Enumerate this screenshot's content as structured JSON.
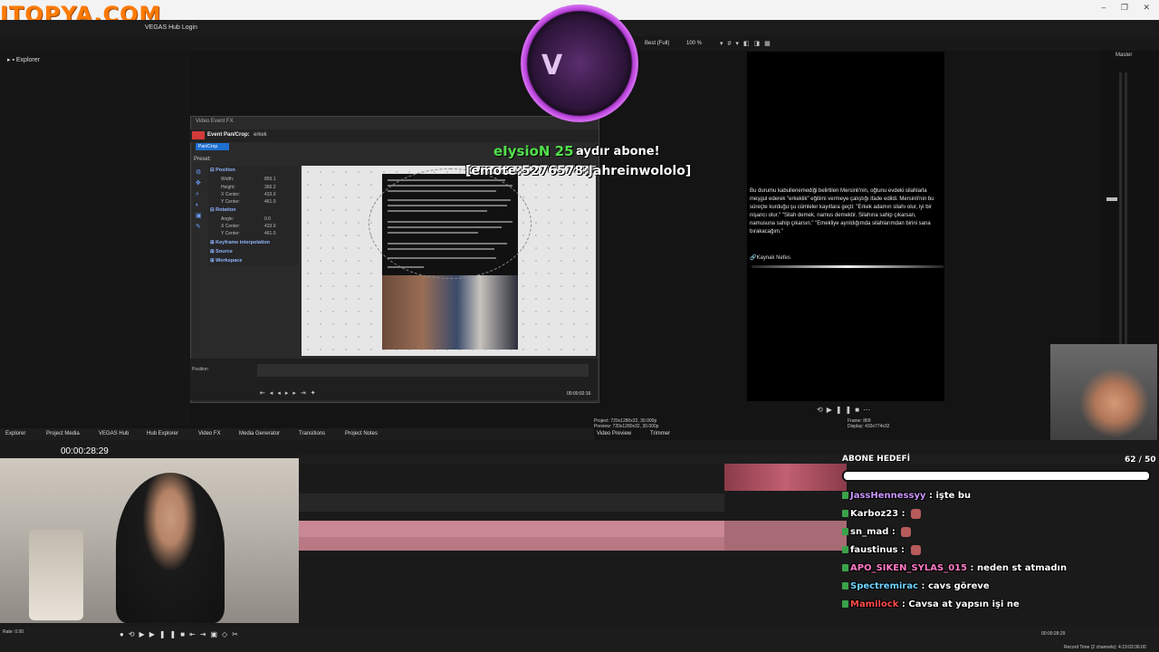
{
  "window": {
    "watermark": "ITOPYA.COM",
    "hub_title": "VEGAS Hub Login",
    "controls": [
      "–",
      "❐",
      "✕"
    ]
  },
  "explorer": {
    "root_label": "Explorer"
  },
  "event_fx": {
    "window_title": "Video Event FX",
    "plugin_title": "Event Pan/Crop:",
    "event_name": "erkek",
    "tab": "Pan/Crop",
    "preset_label": "Preset:",
    "sections": {
      "position": "Position",
      "rotation": "Rotation",
      "keyframe": "Keyframe interpolation",
      "source": "Source",
      "workspace": "Workspace"
    },
    "position_rows": [
      {
        "label": "Width:",
        "value": "859.1"
      },
      {
        "label": "Height:",
        "value": "366.2"
      },
      {
        "label": "X Center:",
        "value": "433.0"
      },
      {
        "label": "Y Center:",
        "value": "461.0"
      }
    ],
    "rotation_rows": [
      {
        "label": "Angle:",
        "value": "0.0"
      },
      {
        "label": "X Center:",
        "value": "433.0"
      },
      {
        "label": "Y Center:",
        "value": "461.0"
      }
    ],
    "timeline_label": "Position",
    "timecode": "00:00:02:16"
  },
  "overlay": {
    "emblem_letter": "V",
    "subscriber_name": "eIysioN 25",
    "subscriber_text": "aydır abone!",
    "emote_text": "[emote:5276578:Jahreinwololo]"
  },
  "preview": {
    "quality": "Best (Full)",
    "zoom": "100 %",
    "article_text": "Bu durumu kabullenemediği belirtilen Mersinli'nin, oğlunu evdeki silahlarla meşgul ederek \"erkeklik\" eğitimi vermeye çalıştığı ifade edildi. Mersinli'nin bu süreçte kurduğu şu cümleler kayıtlara geçti: \"Erkek adamın silahı olur, iyi bir nişancı olur.\" \"Silah demek, namus demektir. Silahına sahip çıkarsan, namusuna sahip çıkarsın.\" \"Emekliye ayrıldığımda silahlarımdan birini sana bırakacağım.\"",
    "source_link": "Kaynak Nefes",
    "project_info": "Project: 720x1280x32, 30.000p",
    "preview_info": "Preview: 720x1280x32, 30.000p",
    "frame_label": "Frame: 869",
    "display_label": "Display: 433x774x32",
    "tab_preview": "Video Preview",
    "tab_trimmer": "Trimmer"
  },
  "master": {
    "label": "Master"
  },
  "bottom_tabs": [
    "Explorer",
    "Project Media",
    "VEGAS Hub",
    "Hub Explorer",
    "Video FX",
    "Media Generator",
    "Transitions",
    "Project Notes"
  ],
  "timeline": {
    "timecode": "00:00:28:29",
    "rate": "Rate: 0.00",
    "bottom_timecode": "00:00:28:29",
    "record_time": "Record Time (2 channels): 4:19:03:36:00"
  },
  "goal": {
    "title": "ABONE HEDEFİ",
    "count": "62 / 50",
    "progress": 1.0
  },
  "chat": [
    {
      "user": "JassHennessyy",
      "color": "#c995ff",
      "message": "işte bu",
      "emote": false
    },
    {
      "user": "Karboz23",
      "color": "#ffffff",
      "message": "",
      "emote": true
    },
    {
      "user": "sn_mad",
      "color": "#ffffff",
      "message": "",
      "emote": true
    },
    {
      "user": "faustinus",
      "color": "#ffffff",
      "message": "",
      "emote": true
    },
    {
      "user": "APO_SIKEN_SYLAS_015",
      "color": "#ff7ac6",
      "message": "neden st atmadın",
      "emote": false
    },
    {
      "user": "Spectremirac",
      "color": "#6fd2ff",
      "message": "cavs göreve",
      "emote": false
    },
    {
      "user": "Mamilock",
      "color": "#ff4b4b",
      "message": "Cavsa at yapsın işi ne",
      "emote": false
    }
  ],
  "colors": {
    "accent": "#1e6fd0",
    "subscriber_green": "#52e04a",
    "emblem_purple": "#b03ad0",
    "audio_clip": "#c98893"
  }
}
